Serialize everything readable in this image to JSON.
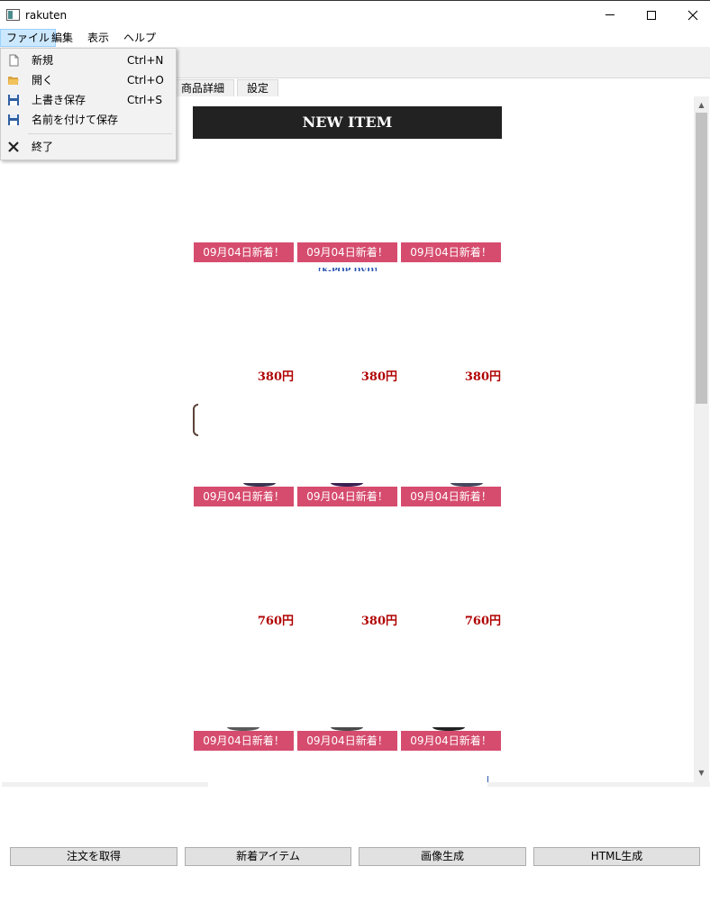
{
  "window": {
    "title": "rakuten",
    "controls": {
      "minimize_icon": "minimize-icon",
      "maximize_icon": "maximize-icon",
      "close_icon": "close-icon"
    }
  },
  "menubar": [
    {
      "label": "ファイル",
      "active": true
    },
    {
      "label": "編集"
    },
    {
      "label": "表示"
    },
    {
      "label": "ヘルプ"
    }
  ],
  "file_menu": [
    {
      "label": "新規",
      "shortcut": "Ctrl+N",
      "icon": "new-file-icon"
    },
    {
      "label": "開く",
      "shortcut": "Ctrl+O",
      "icon": "open-folder-icon"
    },
    {
      "label": "上書き保存",
      "shortcut": "Ctrl+S",
      "icon": "save-icon"
    },
    {
      "label": "名前を付けて保存",
      "shortcut": "",
      "icon": "save-as-icon"
    },
    {
      "label": "終了",
      "shortcut": "",
      "icon": "exit-icon"
    }
  ],
  "tabs": [
    {
      "label": "商品詳細"
    },
    {
      "label": "設定"
    }
  ],
  "preview": {
    "banner": "NEW ITEM",
    "product_caption": "【K-POP DVD】",
    "badges": [
      "09月04日新着！",
      "09月04日新着！",
      "09月04日新着！",
      "09月04日新着！",
      "09月04日新着！",
      "09月04日新着！",
      "09月04日新着！",
      "09月04日新着！",
      "09月04日新着！"
    ],
    "prices": [
      "380円",
      "380円",
      "380円",
      "760円",
      "380円",
      "760円"
    ]
  },
  "buttons": [
    {
      "label": "注文を取得"
    },
    {
      "label": "新着アイテム"
    },
    {
      "label": "画像生成"
    },
    {
      "label": "HTML生成"
    }
  ],
  "colors": {
    "badge": "#d64c6e",
    "price": "#b00000",
    "banner": "#222222",
    "menu_highlight": "#cce8ff"
  }
}
